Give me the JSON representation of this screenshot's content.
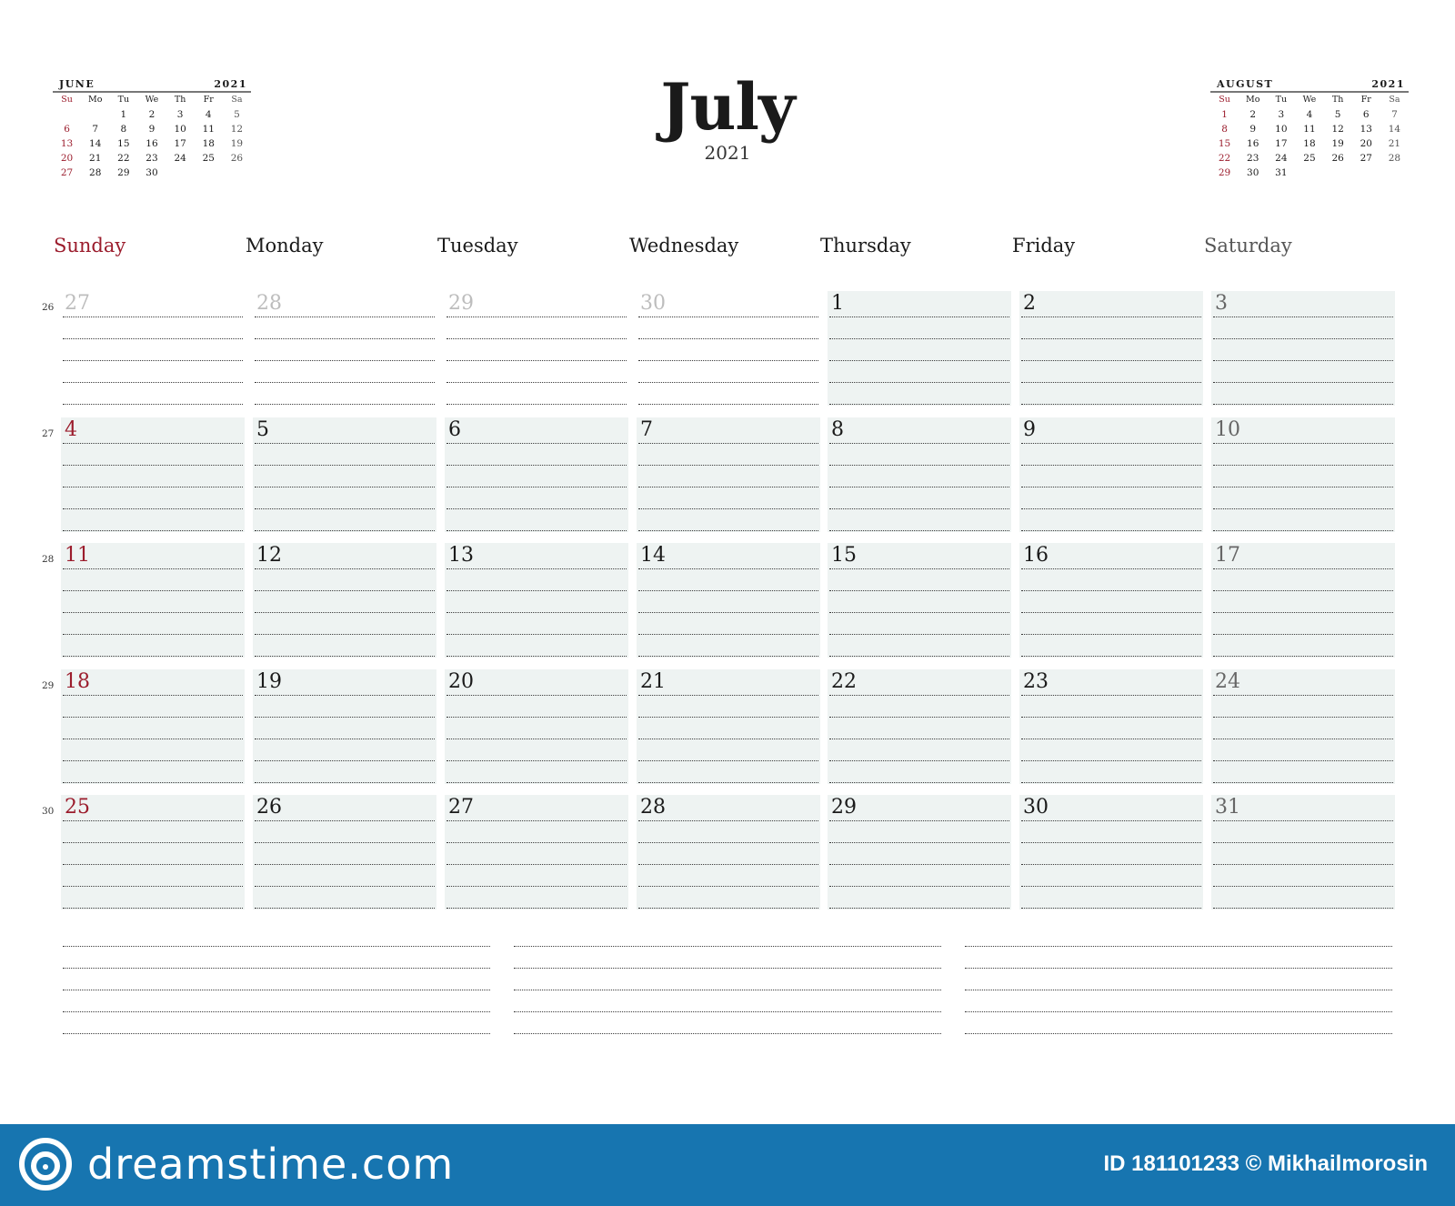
{
  "title": "July",
  "year": "2021",
  "colors": {
    "sunday": "#9b1c2c",
    "cell_bg": "#eef3f2",
    "footer_bg": "#1775b0"
  },
  "day_names": [
    "Sunday",
    "Monday",
    "Tuesday",
    "Wednesday",
    "Thursday",
    "Friday",
    "Saturday"
  ],
  "mini_prev": {
    "month": "JUNE",
    "year": "2021",
    "headers": [
      "Su",
      "Mo",
      "Tu",
      "We",
      "Th",
      "Fr",
      "Sa"
    ],
    "cells": [
      "",
      "",
      "1",
      "2",
      "3",
      "4",
      "5",
      "6",
      "7",
      "8",
      "9",
      "10",
      "11",
      "12",
      "13",
      "14",
      "15",
      "16",
      "17",
      "18",
      "19",
      "20",
      "21",
      "22",
      "23",
      "24",
      "25",
      "26",
      "27",
      "28",
      "29",
      "30"
    ]
  },
  "mini_next": {
    "month": "AUGUST",
    "year": "2021",
    "headers": [
      "Su",
      "Mo",
      "Tu",
      "We",
      "Th",
      "Fr",
      "Sa"
    ],
    "cells": [
      "1",
      "2",
      "3",
      "4",
      "5",
      "6",
      "7",
      "8",
      "9",
      "10",
      "11",
      "12",
      "13",
      "14",
      "15",
      "16",
      "17",
      "18",
      "19",
      "20",
      "21",
      "22",
      "23",
      "24",
      "25",
      "26",
      "27",
      "28",
      "29",
      "30",
      "31"
    ]
  },
  "weeks": [
    {
      "number": "26",
      "days": [
        {
          "d": "27",
          "out": true
        },
        {
          "d": "28",
          "out": true
        },
        {
          "d": "29",
          "out": true
        },
        {
          "d": "30",
          "out": true
        },
        {
          "d": "1"
        },
        {
          "d": "2"
        },
        {
          "d": "3"
        }
      ]
    },
    {
      "number": "27",
      "days": [
        {
          "d": "4"
        },
        {
          "d": "5"
        },
        {
          "d": "6"
        },
        {
          "d": "7"
        },
        {
          "d": "8"
        },
        {
          "d": "9"
        },
        {
          "d": "10"
        }
      ]
    },
    {
      "number": "28",
      "days": [
        {
          "d": "11"
        },
        {
          "d": "12"
        },
        {
          "d": "13"
        },
        {
          "d": "14"
        },
        {
          "d": "15"
        },
        {
          "d": "16"
        },
        {
          "d": "17"
        }
      ]
    },
    {
      "number": "29",
      "days": [
        {
          "d": "18"
        },
        {
          "d": "19"
        },
        {
          "d": "20"
        },
        {
          "d": "21"
        },
        {
          "d": "22"
        },
        {
          "d": "23"
        },
        {
          "d": "24"
        }
      ]
    },
    {
      "number": "30",
      "days": [
        {
          "d": "25"
        },
        {
          "d": "26"
        },
        {
          "d": "27"
        },
        {
          "d": "28"
        },
        {
          "d": "29"
        },
        {
          "d": "30"
        },
        {
          "d": "31"
        }
      ]
    }
  ],
  "footer": {
    "logo_text": "dreamstime.com",
    "credit": "ID 181101233 © Mikhailmorosin"
  }
}
